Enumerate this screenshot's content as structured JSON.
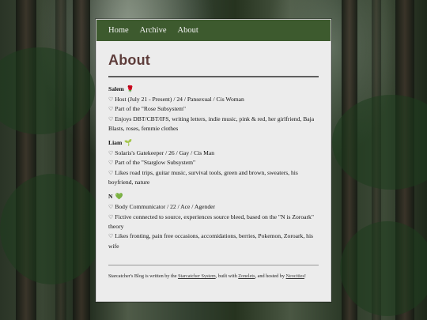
{
  "nav": {
    "home": "Home",
    "archive": "Archive",
    "about": "About"
  },
  "page": {
    "title": "About"
  },
  "members": [
    {
      "name": "Salem",
      "emoji": "🌹",
      "lines": [
        "Host (July 21 - Present) / 24 / Pansexual / Cis Woman",
        "Part of the \"Rose Subsystem\"",
        "Enjoys DBT/CBT/IFS, writing letters, indie music, pink & red, her girlfriend, Baja Blasts, roses, femmie clothes"
      ]
    },
    {
      "name": "Liam",
      "emoji": "🌱",
      "lines": [
        "Solaris's Gatekeeper / 26 / Gay / Cis Man",
        "Part of the \"Starglow Subsystem\"",
        "Likes road trips, guitar music, survival tools, green and brown, sweaters, his boyfriend, nature"
      ]
    },
    {
      "name": "N",
      "emoji": "💚",
      "lines": [
        "Body Communicator / 22 / Ace / Agender",
        "Fictive connected to source, experiences source bleed, based on the \"N is Zoroark\" theory",
        "Likes fronting, pain free occasions, accomidations, berries, Pokemon, Zoroark, his wife"
      ]
    }
  ],
  "footer": {
    "text1": "Starcatcher's Blog is written by the ",
    "link1": "Starcatcher System",
    "text2": ", built with ",
    "link2": "Zonelets",
    "text3": ", and hosted by ",
    "link3": "Neocities",
    "text4": "!"
  },
  "colors": {
    "nav_bg": "#3d5a2e",
    "title": "#5e3d3b",
    "panel_bg": "#ececec"
  }
}
